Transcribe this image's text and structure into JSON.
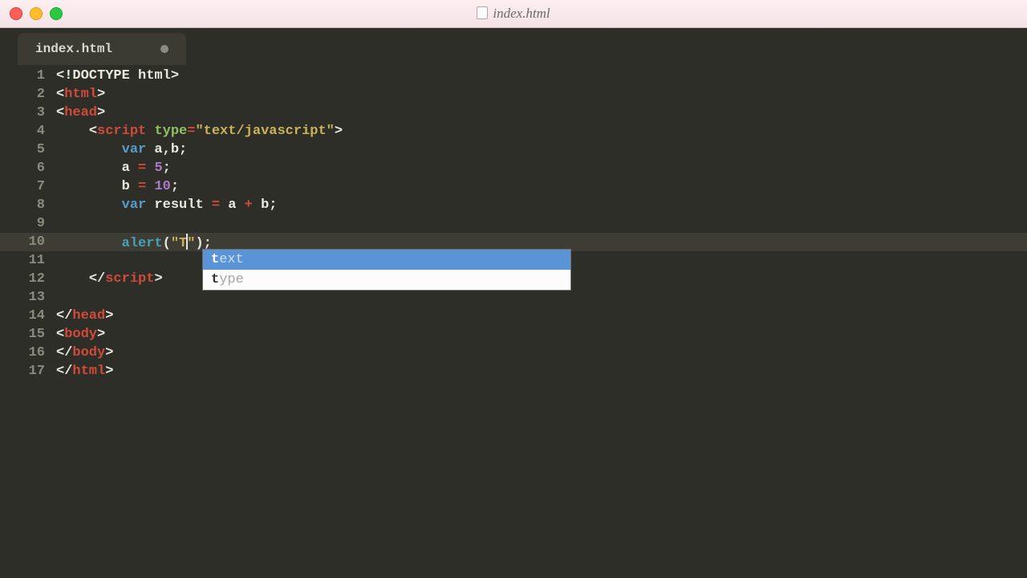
{
  "window": {
    "title": "index.html"
  },
  "tab": {
    "label": "index.html"
  },
  "gutter": [
    "1",
    "2",
    "3",
    "4",
    "5",
    "6",
    "7",
    "8",
    "9",
    "10",
    "11",
    "12",
    "13",
    "14",
    "15",
    "16",
    "17"
  ],
  "active_line_index": 9,
  "code": {
    "l1": [
      {
        "t": "<!DOCTYPE html>",
        "c": "pun"
      }
    ],
    "l2": [
      {
        "t": "<",
        "c": "pun"
      },
      {
        "t": "html",
        "c": "tag"
      },
      {
        "t": ">",
        "c": "pun"
      }
    ],
    "l3": [
      {
        "t": "<",
        "c": "pun"
      },
      {
        "t": "head",
        "c": "tag"
      },
      {
        "t": ">",
        "c": "pun"
      }
    ],
    "l4": [
      {
        "t": "    ",
        "c": "pun"
      },
      {
        "t": "<",
        "c": "pun"
      },
      {
        "t": "script",
        "c": "tag"
      },
      {
        "t": " ",
        "c": "pun"
      },
      {
        "t": "type",
        "c": "attr"
      },
      {
        "t": "=",
        "c": "op"
      },
      {
        "t": "\"text/javascript\"",
        "c": "str"
      },
      {
        "t": ">",
        "c": "pun"
      }
    ],
    "l5": [
      {
        "t": "        ",
        "c": "pun"
      },
      {
        "t": "var",
        "c": "kw"
      },
      {
        "t": " a,b;",
        "c": "nm"
      }
    ],
    "l6": [
      {
        "t": "        a ",
        "c": "nm"
      },
      {
        "t": "=",
        "c": "op"
      },
      {
        "t": " ",
        "c": "nm"
      },
      {
        "t": "5",
        "c": "num"
      },
      {
        "t": ";",
        "c": "nm"
      }
    ],
    "l7": [
      {
        "t": "        b ",
        "c": "nm"
      },
      {
        "t": "=",
        "c": "op"
      },
      {
        "t": " ",
        "c": "nm"
      },
      {
        "t": "10",
        "c": "num"
      },
      {
        "t": ";",
        "c": "nm"
      }
    ],
    "l8": [
      {
        "t": "        ",
        "c": "nm"
      },
      {
        "t": "var",
        "c": "kw"
      },
      {
        "t": " result ",
        "c": "nm"
      },
      {
        "t": "=",
        "c": "op"
      },
      {
        "t": " a ",
        "c": "nm"
      },
      {
        "t": "+",
        "c": "op"
      },
      {
        "t": " b;",
        "c": "nm"
      }
    ],
    "l9": [
      {
        "t": "",
        "c": "nm"
      }
    ],
    "l10": [
      {
        "t": "        ",
        "c": "nm"
      },
      {
        "t": "alert",
        "c": "fn"
      },
      {
        "t": "(",
        "c": "nm"
      },
      {
        "t": "\"T",
        "c": "str"
      },
      {
        "t": "CURSOR",
        "c": "cursor"
      },
      {
        "t": "\"",
        "c": "str"
      },
      {
        "t": ");",
        "c": "nm"
      }
    ],
    "l11": [
      {
        "t": "",
        "c": "nm"
      }
    ],
    "l12": [
      {
        "t": "    ",
        "c": "pun"
      },
      {
        "t": "</",
        "c": "pun"
      },
      {
        "t": "script",
        "c": "tag"
      },
      {
        "t": ">",
        "c": "pun"
      }
    ],
    "l13": [
      {
        "t": "",
        "c": "nm"
      }
    ],
    "l14": [
      {
        "t": "</",
        "c": "pun"
      },
      {
        "t": "head",
        "c": "tag"
      },
      {
        "t": ">",
        "c": "pun"
      }
    ],
    "l15": [
      {
        "t": "<",
        "c": "pun"
      },
      {
        "t": "body",
        "c": "tag"
      },
      {
        "t": ">",
        "c": "pun"
      }
    ],
    "l16": [
      {
        "t": "</",
        "c": "pun"
      },
      {
        "t": "body",
        "c": "tag"
      },
      {
        "t": ">",
        "c": "pun"
      }
    ],
    "l17": [
      {
        "t": "</",
        "c": "pun"
      },
      {
        "t": "html",
        "c": "tag"
      },
      {
        "t": ">",
        "c": "pun"
      }
    ]
  },
  "autocomplete": {
    "items": [
      {
        "match": "t",
        "rest": "ext",
        "selected": true
      },
      {
        "match": "t",
        "rest": "ype",
        "selected": false
      }
    ]
  }
}
